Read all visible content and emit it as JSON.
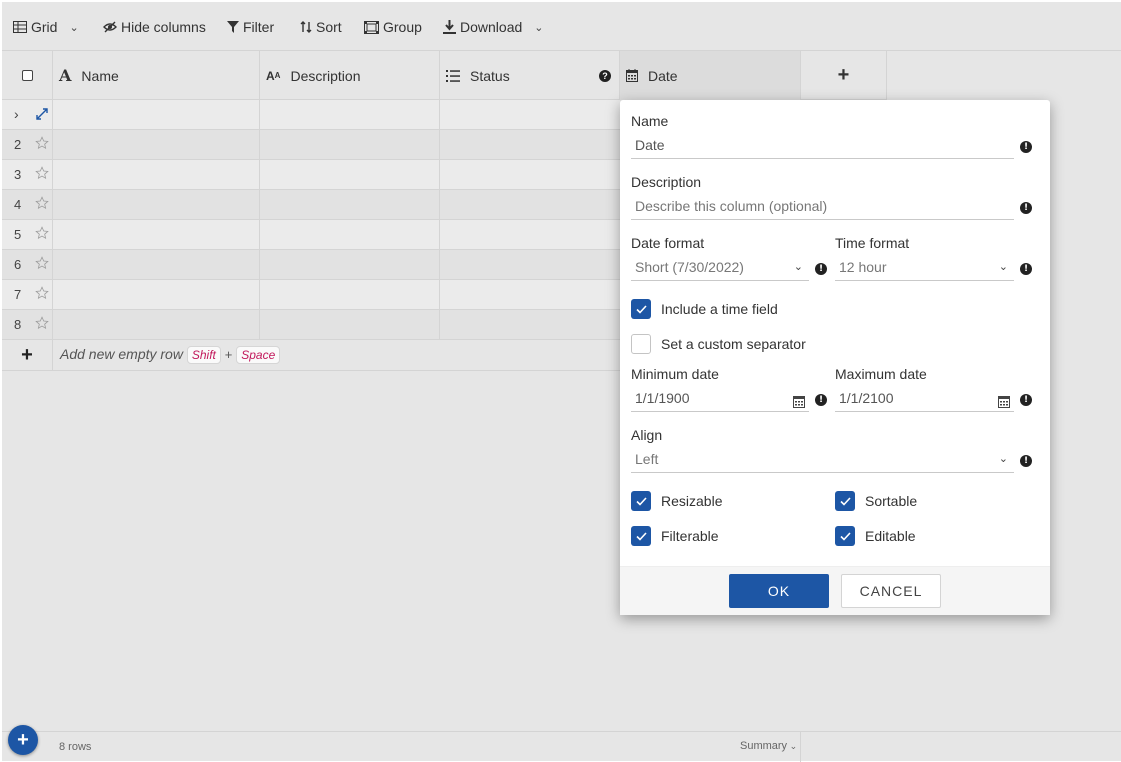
{
  "toolbar": {
    "grid": "Grid",
    "hide_columns": "Hide columns",
    "filter": "Filter",
    "sort": "Sort",
    "group": "Group",
    "download": "Download"
  },
  "columns": {
    "name": "Name",
    "description": "Description",
    "status": "Status",
    "date": "Date",
    "add": "+"
  },
  "rows": [
    "2",
    "3",
    "4",
    "5",
    "6",
    "7",
    "8"
  ],
  "add_row": {
    "label": "Add new empty row",
    "key1": "Shift",
    "plus": "+",
    "key2": "Space"
  },
  "footer": {
    "row_count": "8 rows",
    "summary": "Summary"
  },
  "dialog": {
    "name_label": "Name",
    "name_value": "Date",
    "description_label": "Description",
    "description_placeholder": "Describe this column (optional)",
    "date_format_label": "Date format",
    "date_format_value": "Short (7/30/2022)",
    "time_format_label": "Time format",
    "time_format_value": "12 hour",
    "include_time_label": "Include a time field",
    "include_time_checked": true,
    "custom_separator_label": "Set a custom separator",
    "custom_separator_checked": false,
    "min_date_label": "Minimum date",
    "min_date_value": "1/1/1900",
    "max_date_label": "Maximum date",
    "max_date_value": "1/1/2100",
    "align_label": "Align",
    "align_value": "Left",
    "resizable_label": "Resizable",
    "sortable_label": "Sortable",
    "filterable_label": "Filterable",
    "editable_label": "Editable",
    "ok_label": "OK",
    "cancel_label": "CANCEL"
  },
  "colors": {
    "accent": "#1d56a5",
    "background": "#e6e6e6",
    "key_text": "#c2185b"
  }
}
